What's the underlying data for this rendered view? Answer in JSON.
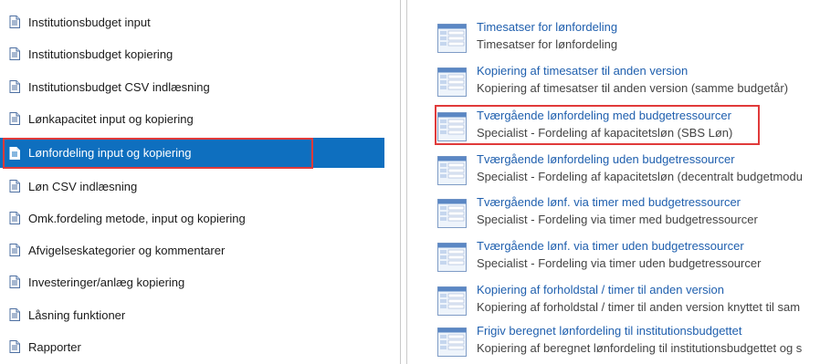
{
  "colors": {
    "accent": "#0e6fbf",
    "link": "#1f5fae",
    "highlight_border": "#e03a3a"
  },
  "left_menu": {
    "items": [
      {
        "label": "Institutionsbudget input",
        "icon": "document-icon"
      },
      {
        "label": "Institutionsbudget kopiering",
        "icon": "document-icon"
      },
      {
        "label": "Institutionsbudget CSV indlæsning",
        "icon": "document-icon"
      },
      {
        "label": "Lønkapacitet input og kopiering",
        "icon": "document-icon"
      },
      {
        "label": "Lønfordeling input og kopiering",
        "icon": "document-icon",
        "selected": true
      },
      {
        "label": "Løn CSV indlæsning",
        "icon": "document-icon"
      },
      {
        "label": "Omk.fordeling metode, input og kopiering",
        "icon": "document-icon"
      },
      {
        "label": "Afvigelseskategorier og kommentarer",
        "icon": "document-icon"
      },
      {
        "label": "Investeringer/anlæg kopiering",
        "icon": "document-icon"
      },
      {
        "label": "Låsning funktioner",
        "icon": "document-icon"
      },
      {
        "label": "Rapporter",
        "icon": "document-icon"
      }
    ]
  },
  "right_panel": {
    "items": [
      {
        "title": "Timesatser for lønfordeling",
        "description": "Timesatser for lønfordeling",
        "icon": "form-icon"
      },
      {
        "title": "Kopiering af timesatser til anden version",
        "description": "Kopiering af timesatser til anden version (samme budgetår)",
        "icon": "form-icon"
      },
      {
        "title": "Tværgående lønfordeling med budgetressourcer",
        "description": "Specialist - Fordeling af kapacitetsløn (SBS Løn)",
        "icon": "form-icon",
        "highlighted": true
      },
      {
        "title": "Tværgående lønfordeling uden budgetressourcer",
        "description": "Specialist - Fordeling af kapacitetsløn (decentralt budgetmodu",
        "icon": "form-icon"
      },
      {
        "title": "Tværgående lønf. via timer med budgetressourcer",
        "description": "Specialist - Fordeling via timer med budgetressourcer",
        "icon": "form-icon"
      },
      {
        "title": "Tværgående lønf. via timer uden budgetressourcer",
        "description": "Specialist - Fordeling via timer uden budgetressourcer",
        "icon": "form-icon"
      },
      {
        "title": "Kopiering af forholdstal / timer til anden version",
        "description": "Kopiering af forholdstal / timer til anden version knyttet til sam",
        "icon": "form-icon"
      },
      {
        "title": "Frigiv beregnet lønfordeling til institutionsbudgettet",
        "description": "Kopiering af beregnet lønfordeling til institutionsbudgettet og s",
        "icon": "form-icon"
      }
    ]
  }
}
